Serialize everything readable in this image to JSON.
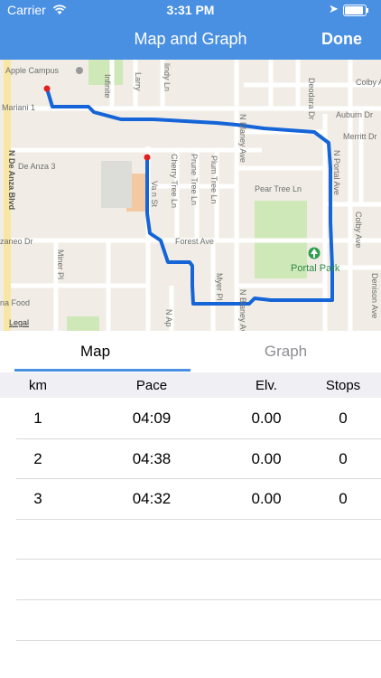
{
  "status": {
    "carrier": "Carrier",
    "time": "3:31 PM"
  },
  "nav": {
    "title": "Map and Graph",
    "done_label": "Done"
  },
  "map": {
    "legal": "Legal",
    "poi": {
      "portal_park": "Portal Park",
      "apple_campus": "Apple Campus"
    },
    "streets": {
      "mariani": "Mariani 1",
      "de_anza_3": "De Anza 3",
      "n_de_anza_blvd": "N De Anza Blvd",
      "infinite": "Infinite",
      "larry": "Larry",
      "lindy_ln": "lindy Ln",
      "n_blaney_ave": "N Blaney Ave",
      "deodara_dr": "Deodara Dr",
      "auburn_dr": "Auburn Dr",
      "merritt_dr": "Merritt Dr",
      "colby_ave_top": "Colby Ave",
      "pear_tree_ln": "Pear Tree Ln",
      "cherry_tree_ln": "Cherry Tree Ln",
      "prune_tree_ln": "Prune Tree Ln",
      "plum_tree_ln": "Plum Tree Ln",
      "n_portal_ave": "N Portal Ave",
      "colby_ave": "Colby Ave",
      "forest_ave": "Forest Ave",
      "zaneo_dr": "zaneo Dr",
      "miner_pl": "Miner Pl",
      "myer_pl": "Myer Pl",
      "n_blaney_ave_lower": "N Blaney Ave",
      "denison_ave": "Denison Ave",
      "na_food": "na Food",
      "n_ap": "N Ap",
      "van_st": "Va n St"
    }
  },
  "tabs": [
    {
      "label": "Map"
    },
    {
      "label": "Graph"
    }
  ],
  "table": {
    "headers": {
      "km": "km",
      "pace": "Pace",
      "elv": "Elv.",
      "stops": "Stops"
    },
    "rows": [
      {
        "km": "1",
        "pace": "04:09",
        "elv": "0.00",
        "stops": "0"
      },
      {
        "km": "2",
        "pace": "04:38",
        "elv": "0.00",
        "stops": "0"
      },
      {
        "km": "3",
        "pace": "04:32",
        "elv": "0.00",
        "stops": "0"
      }
    ]
  },
  "colors": {
    "accent": "#4a90e2",
    "route": "#1565d8",
    "park": "#cfe8b8",
    "road": "#ffffff",
    "map_bg": "#f1ede6"
  }
}
